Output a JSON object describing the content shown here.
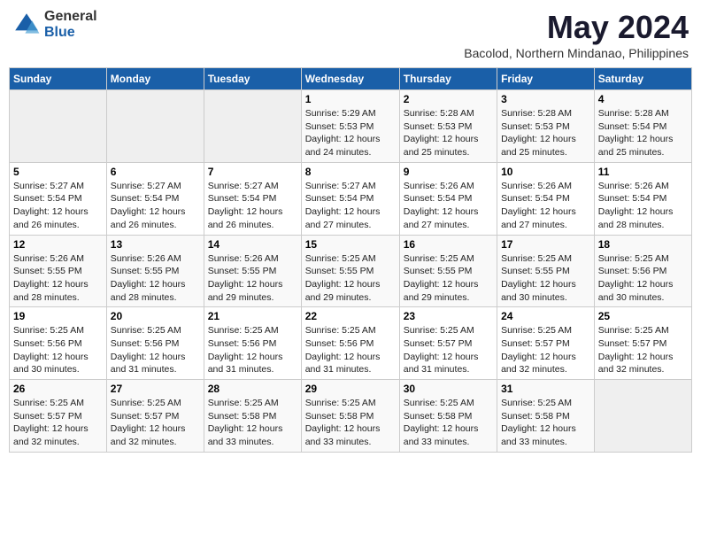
{
  "logo": {
    "general": "General",
    "blue": "Blue"
  },
  "title": "May 2024",
  "location": "Bacolod, Northern Mindanao, Philippines",
  "days_header": [
    "Sunday",
    "Monday",
    "Tuesday",
    "Wednesday",
    "Thursday",
    "Friday",
    "Saturday"
  ],
  "weeks": [
    [
      {
        "day": "",
        "sunrise": "",
        "sunset": "",
        "daylight": ""
      },
      {
        "day": "",
        "sunrise": "",
        "sunset": "",
        "daylight": ""
      },
      {
        "day": "",
        "sunrise": "",
        "sunset": "",
        "daylight": ""
      },
      {
        "day": "1",
        "sunrise": "Sunrise: 5:29 AM",
        "sunset": "Sunset: 5:53 PM",
        "daylight": "Daylight: 12 hours and 24 minutes."
      },
      {
        "day": "2",
        "sunrise": "Sunrise: 5:28 AM",
        "sunset": "Sunset: 5:53 PM",
        "daylight": "Daylight: 12 hours and 25 minutes."
      },
      {
        "day": "3",
        "sunrise": "Sunrise: 5:28 AM",
        "sunset": "Sunset: 5:53 PM",
        "daylight": "Daylight: 12 hours and 25 minutes."
      },
      {
        "day": "4",
        "sunrise": "Sunrise: 5:28 AM",
        "sunset": "Sunset: 5:54 PM",
        "daylight": "Daylight: 12 hours and 25 minutes."
      }
    ],
    [
      {
        "day": "5",
        "sunrise": "Sunrise: 5:27 AM",
        "sunset": "Sunset: 5:54 PM",
        "daylight": "Daylight: 12 hours and 26 minutes."
      },
      {
        "day": "6",
        "sunrise": "Sunrise: 5:27 AM",
        "sunset": "Sunset: 5:54 PM",
        "daylight": "Daylight: 12 hours and 26 minutes."
      },
      {
        "day": "7",
        "sunrise": "Sunrise: 5:27 AM",
        "sunset": "Sunset: 5:54 PM",
        "daylight": "Daylight: 12 hours and 26 minutes."
      },
      {
        "day": "8",
        "sunrise": "Sunrise: 5:27 AM",
        "sunset": "Sunset: 5:54 PM",
        "daylight": "Daylight: 12 hours and 27 minutes."
      },
      {
        "day": "9",
        "sunrise": "Sunrise: 5:26 AM",
        "sunset": "Sunset: 5:54 PM",
        "daylight": "Daylight: 12 hours and 27 minutes."
      },
      {
        "day": "10",
        "sunrise": "Sunrise: 5:26 AM",
        "sunset": "Sunset: 5:54 PM",
        "daylight": "Daylight: 12 hours and 27 minutes."
      },
      {
        "day": "11",
        "sunrise": "Sunrise: 5:26 AM",
        "sunset": "Sunset: 5:54 PM",
        "daylight": "Daylight: 12 hours and 28 minutes."
      }
    ],
    [
      {
        "day": "12",
        "sunrise": "Sunrise: 5:26 AM",
        "sunset": "Sunset: 5:55 PM",
        "daylight": "Daylight: 12 hours and 28 minutes."
      },
      {
        "day": "13",
        "sunrise": "Sunrise: 5:26 AM",
        "sunset": "Sunset: 5:55 PM",
        "daylight": "Daylight: 12 hours and 28 minutes."
      },
      {
        "day": "14",
        "sunrise": "Sunrise: 5:26 AM",
        "sunset": "Sunset: 5:55 PM",
        "daylight": "Daylight: 12 hours and 29 minutes."
      },
      {
        "day": "15",
        "sunrise": "Sunrise: 5:25 AM",
        "sunset": "Sunset: 5:55 PM",
        "daylight": "Daylight: 12 hours and 29 minutes."
      },
      {
        "day": "16",
        "sunrise": "Sunrise: 5:25 AM",
        "sunset": "Sunset: 5:55 PM",
        "daylight": "Daylight: 12 hours and 29 minutes."
      },
      {
        "day": "17",
        "sunrise": "Sunrise: 5:25 AM",
        "sunset": "Sunset: 5:55 PM",
        "daylight": "Daylight: 12 hours and 30 minutes."
      },
      {
        "day": "18",
        "sunrise": "Sunrise: 5:25 AM",
        "sunset": "Sunset: 5:56 PM",
        "daylight": "Daylight: 12 hours and 30 minutes."
      }
    ],
    [
      {
        "day": "19",
        "sunrise": "Sunrise: 5:25 AM",
        "sunset": "Sunset: 5:56 PM",
        "daylight": "Daylight: 12 hours and 30 minutes."
      },
      {
        "day": "20",
        "sunrise": "Sunrise: 5:25 AM",
        "sunset": "Sunset: 5:56 PM",
        "daylight": "Daylight: 12 hours and 31 minutes."
      },
      {
        "day": "21",
        "sunrise": "Sunrise: 5:25 AM",
        "sunset": "Sunset: 5:56 PM",
        "daylight": "Daylight: 12 hours and 31 minutes."
      },
      {
        "day": "22",
        "sunrise": "Sunrise: 5:25 AM",
        "sunset": "Sunset: 5:56 PM",
        "daylight": "Daylight: 12 hours and 31 minutes."
      },
      {
        "day": "23",
        "sunrise": "Sunrise: 5:25 AM",
        "sunset": "Sunset: 5:57 PM",
        "daylight": "Daylight: 12 hours and 31 minutes."
      },
      {
        "day": "24",
        "sunrise": "Sunrise: 5:25 AM",
        "sunset": "Sunset: 5:57 PM",
        "daylight": "Daylight: 12 hours and 32 minutes."
      },
      {
        "day": "25",
        "sunrise": "Sunrise: 5:25 AM",
        "sunset": "Sunset: 5:57 PM",
        "daylight": "Daylight: 12 hours and 32 minutes."
      }
    ],
    [
      {
        "day": "26",
        "sunrise": "Sunrise: 5:25 AM",
        "sunset": "Sunset: 5:57 PM",
        "daylight": "Daylight: 12 hours and 32 minutes."
      },
      {
        "day": "27",
        "sunrise": "Sunrise: 5:25 AM",
        "sunset": "Sunset: 5:57 PM",
        "daylight": "Daylight: 12 hours and 32 minutes."
      },
      {
        "day": "28",
        "sunrise": "Sunrise: 5:25 AM",
        "sunset": "Sunset: 5:58 PM",
        "daylight": "Daylight: 12 hours and 33 minutes."
      },
      {
        "day": "29",
        "sunrise": "Sunrise: 5:25 AM",
        "sunset": "Sunset: 5:58 PM",
        "daylight": "Daylight: 12 hours and 33 minutes."
      },
      {
        "day": "30",
        "sunrise": "Sunrise: 5:25 AM",
        "sunset": "Sunset: 5:58 PM",
        "daylight": "Daylight: 12 hours and 33 minutes."
      },
      {
        "day": "31",
        "sunrise": "Sunrise: 5:25 AM",
        "sunset": "Sunset: 5:58 PM",
        "daylight": "Daylight: 12 hours and 33 minutes."
      },
      {
        "day": "",
        "sunrise": "",
        "sunset": "",
        "daylight": ""
      }
    ]
  ]
}
